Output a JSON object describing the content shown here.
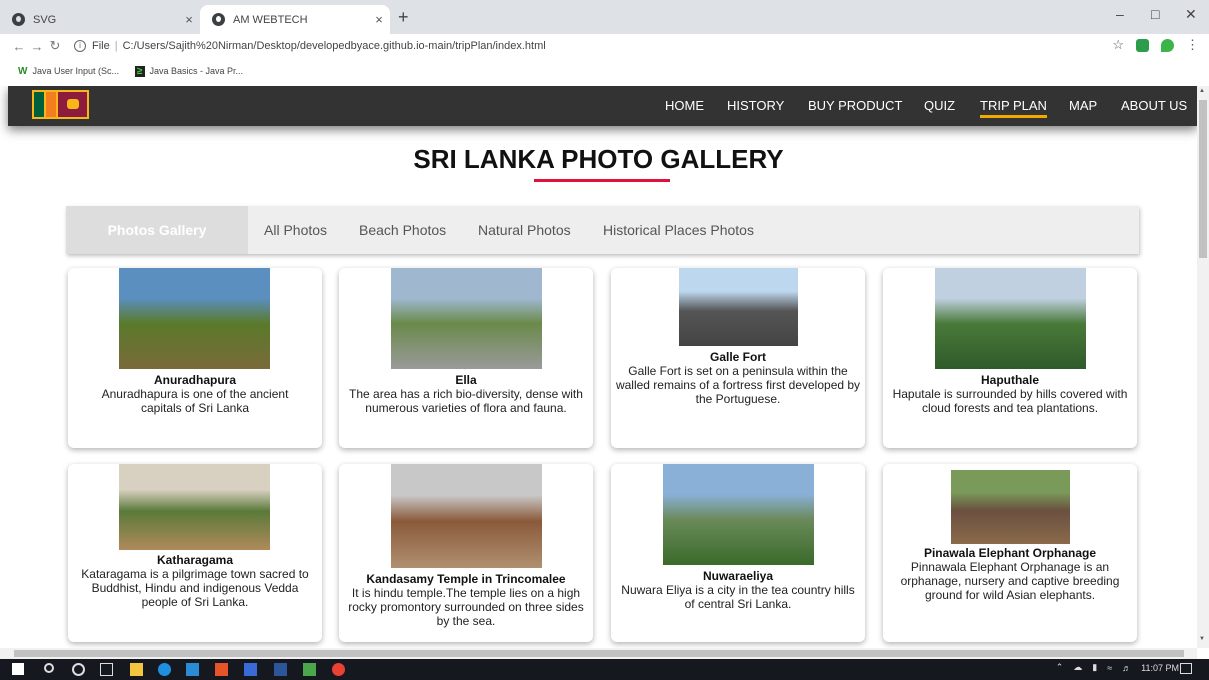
{
  "browser": {
    "tabs": [
      {
        "label": "SVG"
      },
      {
        "label": "AM WEBTECH"
      }
    ],
    "close_glyph": "×",
    "new_tab_glyph": "+",
    "file_label": "File",
    "url": "C:/Users/Sajith%20Nirman/Desktop/developedbyace.github.io-main/tripPlan/index.html",
    "bookmarks": [
      {
        "label": "Java User Input (Sc...",
        "icon": "W"
      },
      {
        "label": "Java Basics - Java Pr...",
        "icon": "≥"
      }
    ]
  },
  "site": {
    "nav": [
      "HOME",
      "HISTORY",
      "BUY PRODUCT",
      "QUIZ",
      "TRIP PLAN",
      "MAP",
      "ABOUT US"
    ],
    "active_nav": "TRIP PLAN",
    "page_title": "SRI LANKA PHOTO GALLERY",
    "filters": [
      "Photos Gallery",
      "All Photos",
      "Beach Photos",
      "Natural Photos",
      "Historical Places Photos"
    ],
    "accent_color": "#e0123b",
    "cards": [
      {
        "name": "Anuradhapura",
        "desc": "Anuradhapura is one of the ancient capitals of Sri Lanka",
        "img_colors": [
          "#5a8fbf",
          "#5a7a2a",
          "#7a6a3a"
        ]
      },
      {
        "name": "Ella",
        "desc": "The area has a rich bio-diversity, dense with numerous varieties of flora and fauna.",
        "img_colors": [
          "#9fb8d0",
          "#6a8a4a",
          "#9a9a9a"
        ]
      },
      {
        "name": "Galle Fort",
        "desc": "Galle Fort is set on a peninsula within the walled remains of a fortress first developed by the Portuguese.",
        "img_colors": [
          "#bcd7ee",
          "#555555",
          "#444444"
        ]
      },
      {
        "name": "Haputhale",
        "desc": "Haputale is surrounded by hills covered with cloud forests and tea plantations.",
        "img_colors": [
          "#c0d0e0",
          "#4a7a3a",
          "#2f5a2a"
        ]
      },
      {
        "name": "Katharagama",
        "desc": "Kataragama is a pilgrimage town sacred to Buddhist, Hindu and indigenous Vedda people of Sri Lanka.",
        "img_colors": [
          "#d8d0c0",
          "#5a7a3a",
          "#b08a5a"
        ]
      },
      {
        "name": "Kandasamy Temple in Trincomalee",
        "desc": "It is hindu temple.The temple lies on a high rocky promontory surrounded on three sides by the sea.",
        "img_colors": [
          "#c8c8c8",
          "#8a5a3a",
          "#b09070"
        ]
      },
      {
        "name": "Nuwaraeliya",
        "desc": "Nuwara Eliya is a city in the tea country hills of central Sri Lanka.",
        "img_colors": [
          "#8ab0d8",
          "#6a8a5a",
          "#3a6a2a"
        ]
      },
      {
        "name": "Pinawala Elephant Orphanage",
        "desc": "Pinnawala Elephant Orphanage is an orphanage, nursery and captive breeding ground for wild Asian elephants.",
        "img_colors": [
          "#7a9a5a",
          "#6a5040",
          "#8a6a4a"
        ]
      }
    ]
  },
  "taskbar": {
    "time": "11:07 PM"
  }
}
